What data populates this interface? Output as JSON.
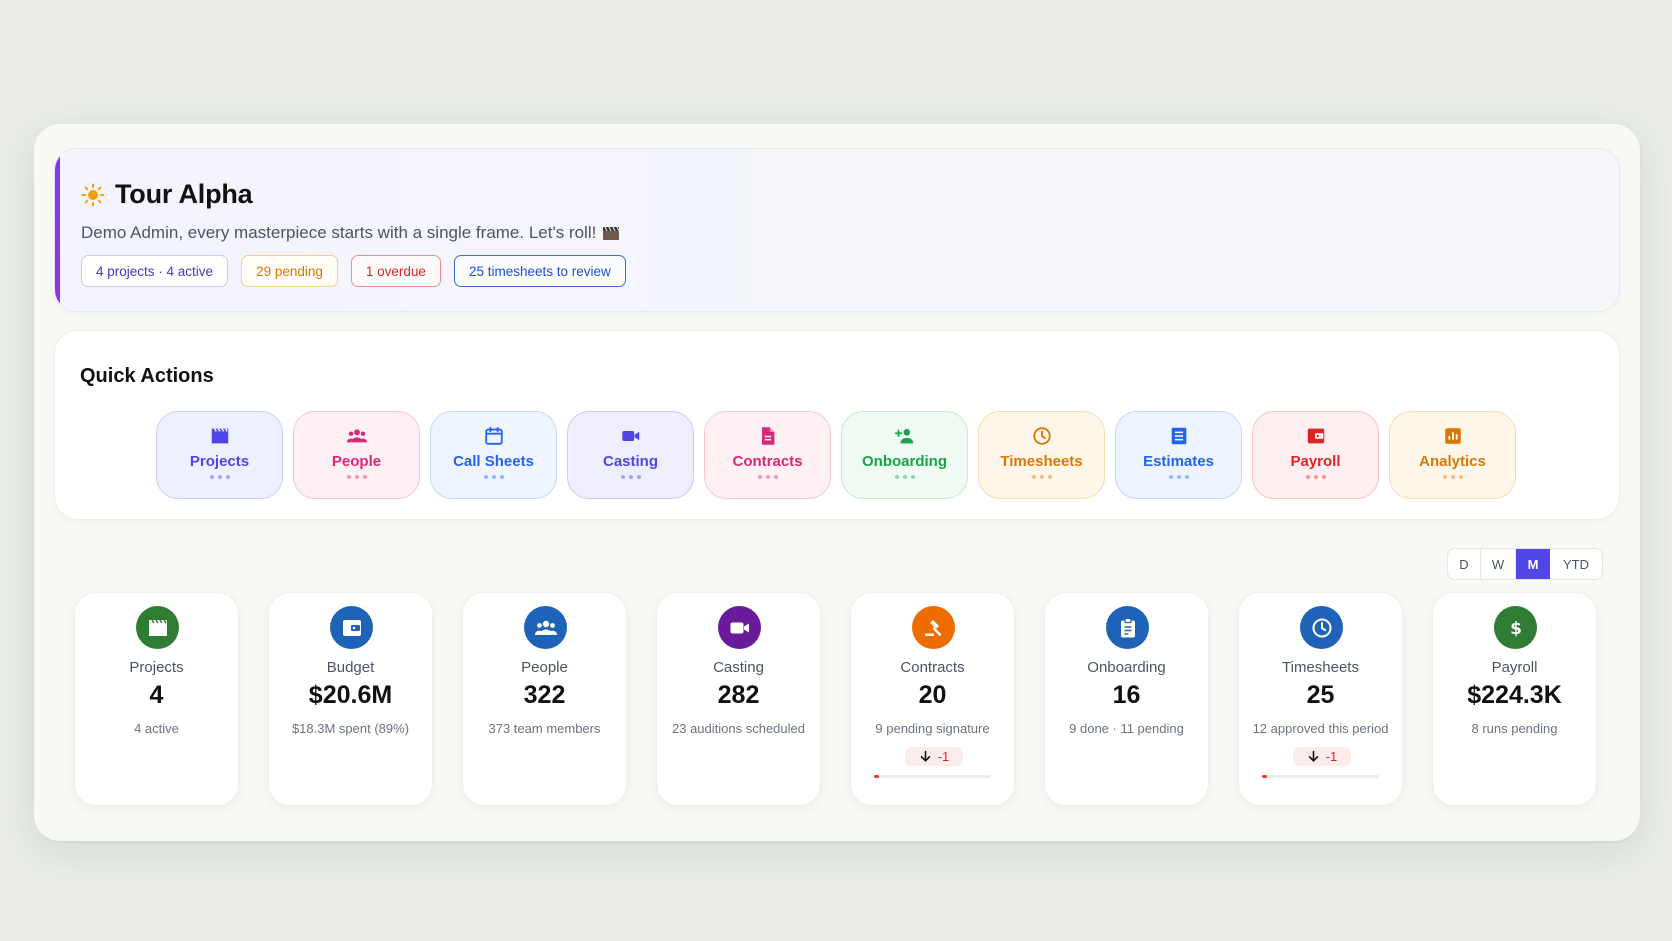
{
  "hero": {
    "title": "Tour Alpha",
    "subtitle": "Demo Admin, every masterpiece starts with a single frame. Let's roll!",
    "chips": [
      "4 projects · 4 active",
      "29 pending",
      "1 overdue",
      "25 timesheets to review"
    ]
  },
  "quick_actions": {
    "title": "Quick Actions",
    "items": [
      {
        "label": "Projects",
        "icon": "clapperboard-icon",
        "color": "#4f46e5",
        "bg": "#eef0ff",
        "border": "#c9cdf5"
      },
      {
        "label": "People",
        "icon": "people-icon",
        "color": "#db2777",
        "bg": "#fdf0f5",
        "border": "#f6c4d8"
      },
      {
        "label": "Call Sheets",
        "icon": "calendar-icon",
        "color": "#2563eb",
        "bg": "#eff5ff",
        "border": "#c6d8f6"
      },
      {
        "label": "Casting",
        "icon": "video-camera-icon",
        "color": "#4f46e5",
        "bg": "#eeeeff",
        "border": "#c9c9f5"
      },
      {
        "label": "Contracts",
        "icon": "document-icon",
        "color": "#db2777",
        "bg": "#fdf1f4",
        "border": "#f6c6d3"
      },
      {
        "label": "Onboarding",
        "icon": "person-add-icon",
        "color": "#16a34a",
        "bg": "#effaf3",
        "border": "#c3ead0"
      },
      {
        "label": "Timesheets",
        "icon": "clock-icon",
        "color": "#d97706",
        "bg": "#fff6ea",
        "border": "#f6dcb6"
      },
      {
        "label": "Estimates",
        "icon": "list-icon",
        "color": "#2563eb",
        "bg": "#eef4ff",
        "border": "#c6d7f6"
      },
      {
        "label": "Payroll",
        "icon": "wallet-icon",
        "color": "#dc2626",
        "bg": "#fdefef",
        "border": "#f4c3c3"
      },
      {
        "label": "Analytics",
        "icon": "bar-chart-icon",
        "color": "#d97706",
        "bg": "#fff6ea",
        "border": "#f6dcb6"
      }
    ]
  },
  "period": {
    "options": [
      "D",
      "W",
      "M",
      "YTD"
    ],
    "selected": "M"
  },
  "stats": [
    {
      "label": "Projects",
      "value": "4",
      "sub": "4 active",
      "icon": "clapperboard-icon",
      "color": "#2e7d32"
    },
    {
      "label": "Budget",
      "value": "$20.6M",
      "sub": "$18.3M spent (89%)",
      "icon": "wallet-icon",
      "color": "#1e63b8"
    },
    {
      "label": "People",
      "value": "322",
      "sub": "373 team members",
      "icon": "people-icon",
      "color": "#1e63b8"
    },
    {
      "label": "Casting",
      "value": "282",
      "sub": "23 auditions scheduled",
      "icon": "video-camera-icon",
      "color": "#6a1b9a"
    },
    {
      "label": "Contracts",
      "value": "20",
      "sub": "9 pending signature",
      "icon": "gavel-icon",
      "color": "#ef6c00",
      "delta": "-1",
      "progress": 0.04
    },
    {
      "label": "Onboarding",
      "value": "16",
      "sub": "9 done · 11 pending",
      "icon": "clipboard-icon",
      "color": "#1e63b8"
    },
    {
      "label": "Timesheets",
      "value": "25",
      "sub": "12 approved this period",
      "icon": "clock-icon",
      "color": "#1e63b8",
      "delta": "-1",
      "progress": 0.04
    },
    {
      "label": "Payroll",
      "value": "$224.3K",
      "sub": "8 runs pending",
      "icon": "dollar-icon",
      "color": "#2e7d32"
    }
  ]
}
